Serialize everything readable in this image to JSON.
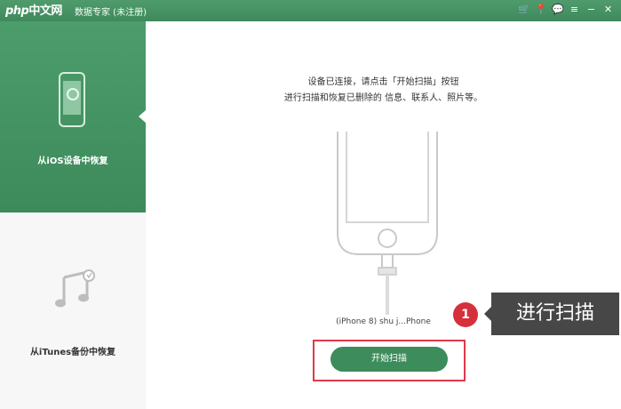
{
  "watermark": {
    "part1": "php",
    "part2": "中文网"
  },
  "titlebar": {
    "title": "数据专家 (未注册)",
    "icons": [
      "cart-icon",
      "pin-icon",
      "chat-icon",
      "menu-icon",
      "minimize-icon",
      "close-icon"
    ]
  },
  "sidebar": {
    "ios_label": "从iOS设备中恢复",
    "itunes_label": "从iTunes备份中恢复"
  },
  "main": {
    "instruction_line1": "设备已连接，请点击「开始扫描」按钮",
    "instruction_line2": "进行扫描和恢复已删除的 信息、联系人、照片等。",
    "device_label": "(iPhone 8) shu j...Phone",
    "scan_button": "开始扫描"
  },
  "annotation": {
    "step_number": "1",
    "callout_text": "进行扫描"
  },
  "colors": {
    "brand_green": "#3f8a5c",
    "highlight_red": "#e0394a",
    "callout_bg": "#474747"
  }
}
